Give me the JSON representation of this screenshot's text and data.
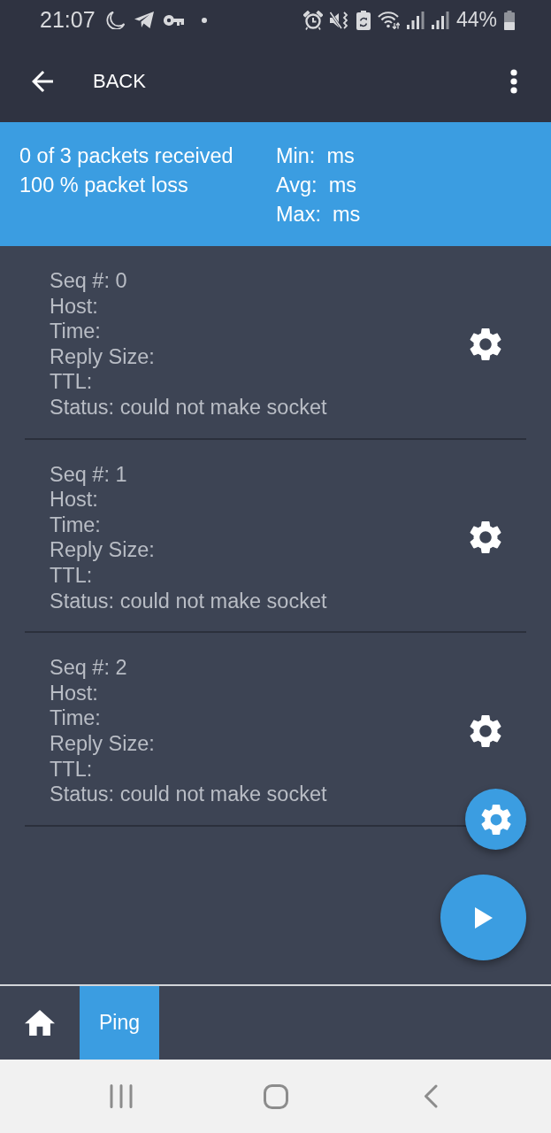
{
  "status_bar": {
    "time": "21:07",
    "battery": "44%"
  },
  "app_bar": {
    "back_label": "BACK"
  },
  "summary": {
    "received": "0 of 3 packets received",
    "loss": "100 % packet loss",
    "min": "Min:  ms",
    "avg": "Avg:  ms",
    "max": "Max:  ms"
  },
  "results": [
    {
      "seq": "Seq #: 0",
      "host": "Host:",
      "time": "Time:",
      "reply_size": "Reply Size:",
      "ttl": "TTL:",
      "status": "Status: could not make socket"
    },
    {
      "seq": "Seq #: 1",
      "host": "Host:",
      "time": "Time:",
      "reply_size": "Reply Size:",
      "ttl": "TTL:",
      "status": "Status: could not make socket"
    },
    {
      "seq": "Seq #: 2",
      "host": "Host:",
      "time": "Time:",
      "reply_size": "Reply Size:",
      "ttl": "TTL:",
      "status": "Status: could not make socket"
    }
  ],
  "bottom_tabs": [
    {
      "kind": "icon",
      "selected": false
    },
    {
      "kind": "text",
      "label": "Ping",
      "selected": true
    }
  ]
}
